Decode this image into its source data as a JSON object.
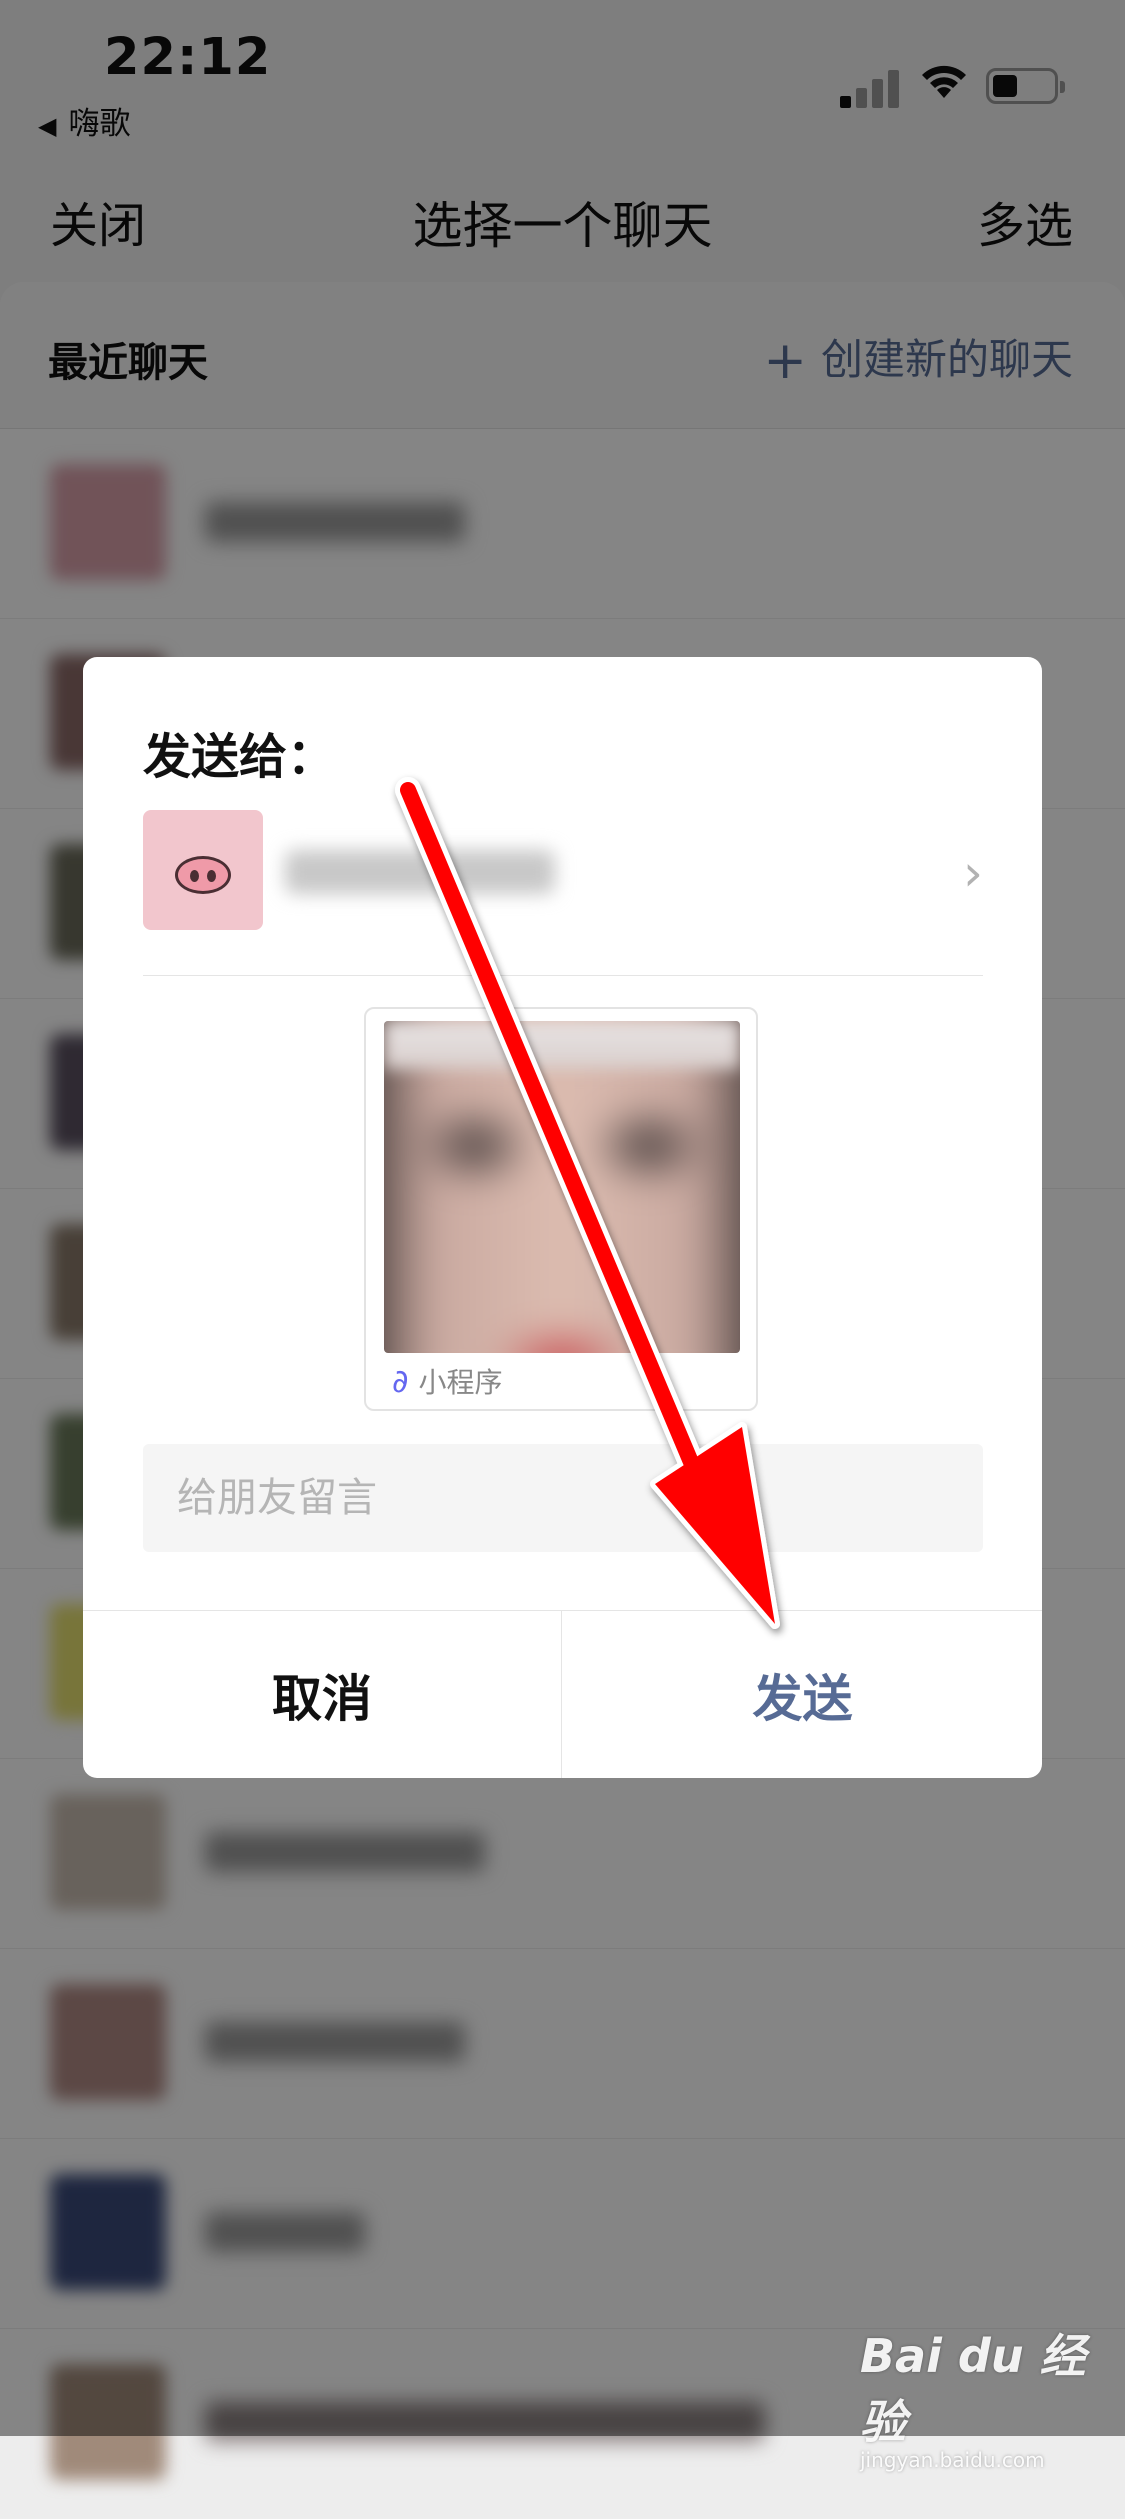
{
  "status_bar": {
    "time": "22:12",
    "back_app": "嗨歌"
  },
  "nav": {
    "close": "关闭",
    "title": "选择一个聊天",
    "multi_select": "多选"
  },
  "recent": {
    "label": "最近聊天",
    "create_new": "创建新的聊天"
  },
  "dialog": {
    "send_to_label": "发送给：",
    "card_label": "小程序",
    "message_placeholder": "给朋友留言",
    "cancel": "取消",
    "send": "发送"
  },
  "colors": {
    "link_blue": "#576b95",
    "annotation_arrow": "#ff0000",
    "mini_program_icon": "#6467f0"
  },
  "watermark": {
    "brand": "Bai du 经验",
    "url": "jingyan.baidu.com"
  }
}
